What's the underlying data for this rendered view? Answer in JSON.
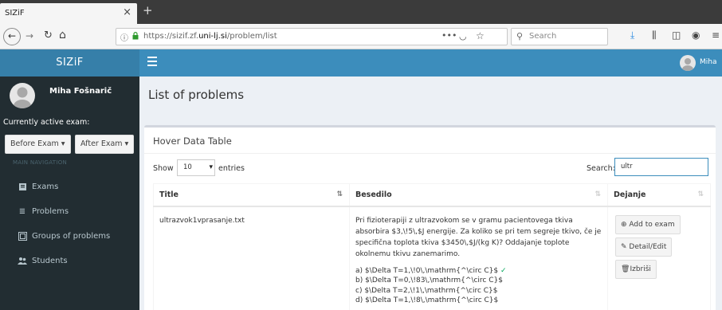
{
  "browser": {
    "tab_title": "SIZiF",
    "tab_close": "×",
    "new_tab": "+",
    "url_prefix": "https://sizif.zf.",
    "url_domain": "uni-lj.si",
    "url_path": "/problem/list",
    "search_placeholder": "Search"
  },
  "app": {
    "brand": "SIZiF",
    "top_user": "Miha"
  },
  "sidebar": {
    "user_name": "Miha Fošnarič",
    "active_exam_label": "Currently active exam:",
    "before_exam_button": "Before Exam ▾",
    "after_exam_button": "After Exam ▾",
    "nav_header": "MAIN NAVIGATION",
    "items": [
      {
        "label": "Exams",
        "icon": "book-icon"
      },
      {
        "label": "Problems",
        "icon": "list-icon"
      },
      {
        "label": "Groups of problems",
        "icon": "group-icon"
      },
      {
        "label": "Students",
        "icon": "users-icon"
      }
    ]
  },
  "main": {
    "page_title": "List of problems",
    "box_title": "Hover Data Table",
    "show_label": "Show",
    "entries_value": "10",
    "entries_label": "entries",
    "search_label": "Search:",
    "search_value": "ultr",
    "table": {
      "columns": [
        "Title",
        "Besedilo",
        "Dejanje"
      ],
      "rows": [
        {
          "title": "ultrazvok1vprasanje.txt",
          "text": "Pri fizioterapiji z ultrazvokom se v gramu pacientovega tkiva absorbira $3,\\!5\\,$J energije. Za koliko se pri tem segreje tkivo, če je specifična toplota tkiva $3450\\,$J/(kg K)? Oddajanje toplote okolnemu tkivu zanemarimo.",
          "answers": [
            "a) $\\Delta T=1,\\!0\\,\\mathrm{^\\circ C}$",
            "b) $\\Delta T=0,\\!83\\,\\mathrm{^\\circ C}$",
            "c) $\\Delta T=2,\\!1\\,\\mathrm{^\\circ C}$",
            "d) $\\Delta T=1,\\!8\\,\\mathrm{^\\circ C}$"
          ],
          "correct_mark": "✓",
          "actions": [
            "Add to exam",
            "Detail/Edit",
            "Izbriši"
          ]
        }
      ]
    }
  },
  "colors": {
    "brand_bg": "#367fa9",
    "header_bg": "#3c8dbc",
    "sidebar_bg": "#222d32",
    "content_bg": "#ecf0f5",
    "correct": "#00a65a"
  }
}
